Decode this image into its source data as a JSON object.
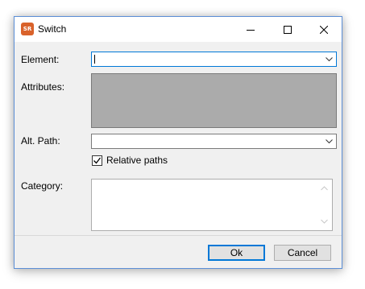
{
  "window": {
    "title": "Switch",
    "app_icon_text": "SR",
    "controls": {
      "minimize_icon": "minimize-icon",
      "maximize_icon": "maximize-icon",
      "close_icon": "close-icon"
    }
  },
  "form": {
    "element": {
      "label": "Element:",
      "value": ""
    },
    "attributes": {
      "label": "Attributes:"
    },
    "alt_path": {
      "label": "Alt. Path:",
      "value": ""
    },
    "relative_paths": {
      "label": "Relative paths",
      "checked": true
    },
    "category": {
      "label": "Category:",
      "value": ""
    }
  },
  "buttons": {
    "ok_label": "Ok",
    "cancel_label": "Cancel"
  },
  "colors": {
    "window_border": "#5b8ed6",
    "focus_accent": "#0078d7",
    "app_icon": "#d9622b",
    "attributes_fill": "#ababab"
  }
}
